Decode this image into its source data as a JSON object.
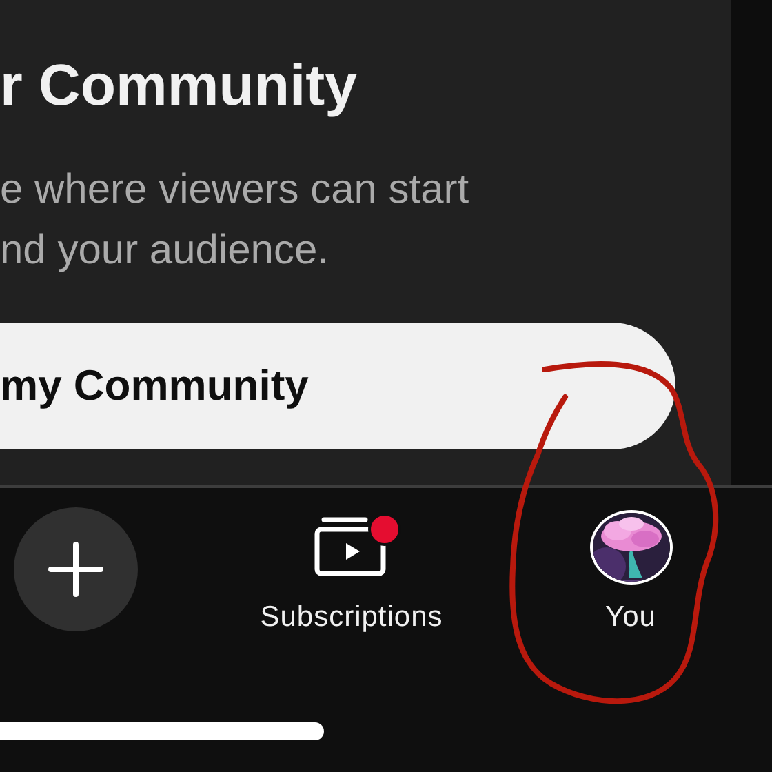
{
  "community_card": {
    "title": "r Community",
    "description": "e where viewers can start\nnd your audience.",
    "button": "my Community"
  },
  "bottom_nav": [
    {
      "kind": "create"
    },
    {
      "kind": "subscriptions",
      "label": "Subscriptions",
      "new_badge": true
    },
    {
      "kind": "you",
      "label": "You"
    }
  ]
}
